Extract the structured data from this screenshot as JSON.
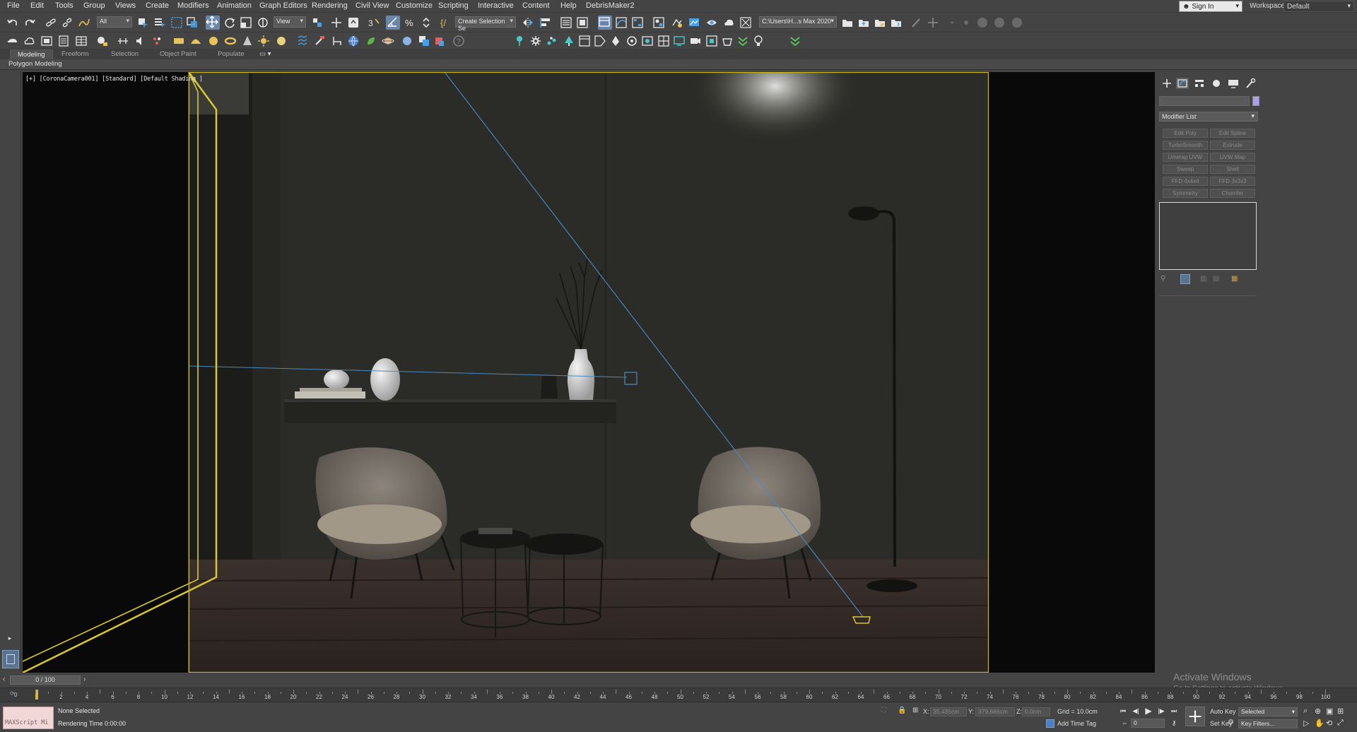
{
  "menus": [
    "File",
    "Edit",
    "Tools",
    "Group",
    "Views",
    "Create",
    "Modifiers",
    "Animation",
    "Graph Editors",
    "Rendering",
    "Civil View",
    "Customize",
    "Scripting",
    "Interactive",
    "Content",
    "Help",
    "DebrisMaker2"
  ],
  "account": {
    "sign_in": "Sign In",
    "workspaces_label": "Workspaces:",
    "workspace": "Default"
  },
  "toolbar": {
    "selection_filter": "All",
    "reference_coord": "View",
    "selection_set_placeholder": "Create Selection Se",
    "project_path": "C:\\Users\\H...s Max 2020"
  },
  "ribbon": {
    "tabs": [
      "Modeling",
      "Freeform",
      "Selection",
      "Object Paint",
      "Populate"
    ],
    "active_tab": "Modeling",
    "panel_label": "Polygon Modeling"
  },
  "viewport": {
    "label": "[+] [CoronaCamera001] [Standard] [Default Shading ]"
  },
  "command_panel": {
    "modifier_list": "Modifier List",
    "modifier_buttons": [
      "Edit Poly",
      "Edit Spline",
      "TurboSmooth",
      "Extrude",
      "Unwrap UVW",
      "UVW Map",
      "Sweep",
      "Shell",
      "FFD 4x4x4",
      "FFD 3x3x3",
      "Symmetry",
      "Chamfer"
    ],
    "swatch_color": "#a8a0e8"
  },
  "timeline": {
    "frame_counter": "0 / 100",
    "ticks": [
      2,
      4,
      6,
      8,
      10,
      12,
      14,
      16,
      18,
      20,
      22,
      24,
      26,
      28,
      30,
      32,
      34,
      36,
      38,
      40,
      42,
      44,
      46,
      48,
      50,
      52,
      54,
      56,
      58,
      60,
      62,
      64,
      66,
      68,
      70,
      72,
      74,
      76,
      78,
      80,
      82,
      84,
      86,
      88,
      90,
      92,
      94,
      96,
      98,
      100
    ],
    "zero_label": "0"
  },
  "activate_windows": {
    "title": "Activate Windows",
    "subtitle": "Go to Settings to activate Windows."
  },
  "status": {
    "maxscript": "MAXScript Mi",
    "selection": "None Selected",
    "rendering_time_label": "Rendering Time",
    "rendering_time": "0:00:00",
    "x_label": "X:",
    "x_value": "35.435cm",
    "y_label": "Y:",
    "y_value": "379.666cm",
    "z_label": "Z:",
    "z_value": "0.0cm",
    "grid": "Grid = 10.0cm",
    "add_time_tag": "Add Time Tag",
    "auto_key": "Auto Key",
    "set_key": "Set Key",
    "key_mode": "Selected",
    "key_filters": "Key Filters...",
    "current_frame": "0"
  }
}
